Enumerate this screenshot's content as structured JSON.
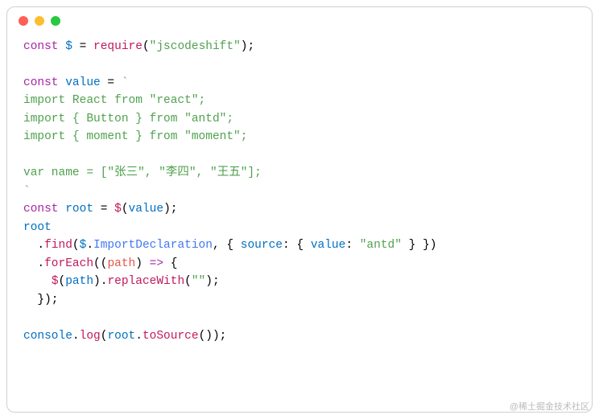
{
  "line1": {
    "kw": "const",
    "v": "$",
    "eq": " = ",
    "req": "require",
    "p1": "(",
    "s": "\"jscodeshift\"",
    "p2": ");"
  },
  "blank1": "",
  "line2": {
    "kw": "const",
    "v": "value",
    "eq": " = ",
    "tick": "`"
  },
  "line3": "import React from \"react\";",
  "line4": "import { Button } from \"antd\";",
  "line5": "import { moment } from \"moment\";",
  "blank2": "",
  "line6": "var name = [\"张三\", \"李四\", \"王五\"];",
  "line7": "`",
  "line8": {
    "kw": "const",
    "v": "root",
    "eq": " = ",
    "fn": "$",
    "p1": "(",
    "arg": "value",
    "p2": ");"
  },
  "line9": "root",
  "line10": {
    "indent": "  .",
    "fn": "find",
    "p1": "(",
    "obj": "$",
    "dot": ".",
    "prop": "ImportDeclaration",
    "c1": ", { ",
    "k1": "source",
    "c2": ": { ",
    "k2": "value",
    "c3": ": ",
    "val": "\"antd\"",
    "c4": " } })"
  },
  "line11": {
    "indent": "  .",
    "fn": "forEach",
    "p1": "((",
    "arg": "path",
    "p2": ") ",
    "arrow": "=>",
    "p3": " {"
  },
  "line12": {
    "indent": "    ",
    "fn": "$",
    "p1": "(",
    "arg": "path",
    "p2": ").",
    "m": "replaceWith",
    "p3": "(",
    "s": "\"\"",
    "p4": ");"
  },
  "line13": "  });",
  "blank3": "",
  "line14": {
    "obj": "console",
    "dot": ".",
    "m": "log",
    "p1": "(",
    "arg": "root",
    "dot2": ".",
    "m2": "toSource",
    "p2": "());"
  },
  "watermark": "@稀土掘金技术社区"
}
